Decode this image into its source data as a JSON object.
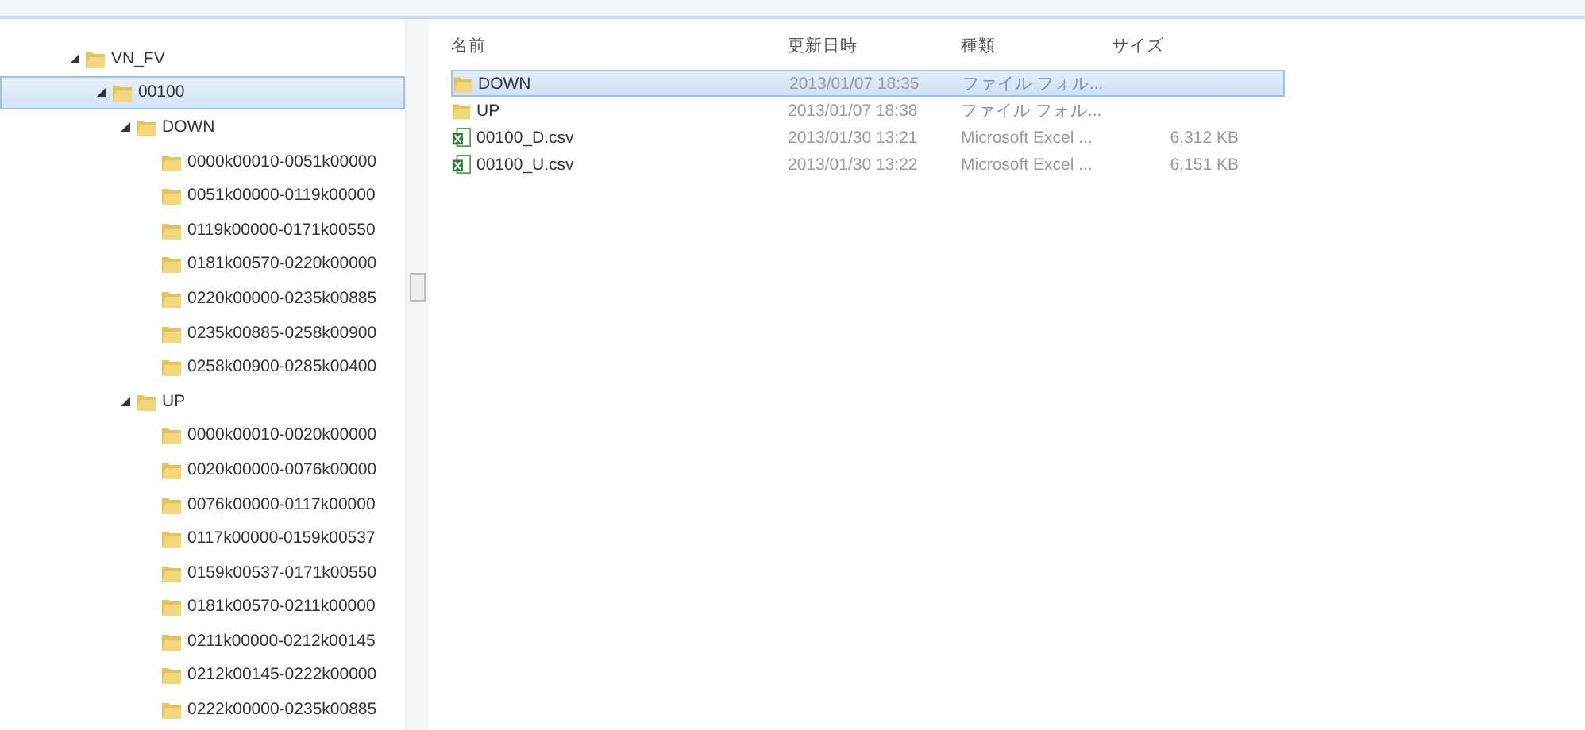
{
  "tree": [
    {
      "label": "VN_FV",
      "expanded": true,
      "selected": false,
      "children": [
        {
          "label": "00100",
          "expanded": true,
          "selected": true,
          "children": [
            {
              "label": "DOWN",
              "expanded": true,
              "selected": false,
              "children": [
                {
                  "label": "0000k00010-0051k00000",
                  "selected": false
                },
                {
                  "label": "0051k00000-0119k00000",
                  "selected": false
                },
                {
                  "label": "0119k00000-0171k00550",
                  "selected": false
                },
                {
                  "label": "0181k00570-0220k00000",
                  "selected": false
                },
                {
                  "label": "0220k00000-0235k00885",
                  "selected": false
                },
                {
                  "label": "0235k00885-0258k00900",
                  "selected": false
                },
                {
                  "label": "0258k00900-0285k00400",
                  "selected": false
                }
              ]
            },
            {
              "label": "UP",
              "expanded": true,
              "selected": false,
              "children": [
                {
                  "label": "0000k00010-0020k00000",
                  "selected": false
                },
                {
                  "label": "0020k00000-0076k00000",
                  "selected": false
                },
                {
                  "label": "0076k00000-0117k00000",
                  "selected": false
                },
                {
                  "label": "0117k00000-0159k00537",
                  "selected": false
                },
                {
                  "label": "0159k00537-0171k00550",
                  "selected": false
                },
                {
                  "label": "0181k00570-0211k00000",
                  "selected": false
                },
                {
                  "label": "0211k00000-0212k00145",
                  "selected": false
                },
                {
                  "label": "0212k00145-0222k00000",
                  "selected": false
                },
                {
                  "label": "0222k00000-0235k00885",
                  "selected": false
                }
              ]
            }
          ]
        }
      ]
    }
  ],
  "columns": [
    "名前",
    "更新日時",
    "種類",
    "サイズ"
  ],
  "files": [
    {
      "kind": "folder",
      "name": "DOWN",
      "date": "2013/01/07 18:35",
      "type": "ファイル フォル...",
      "selected": true
    },
    {
      "kind": "folder",
      "name": "UP",
      "date": "2013/01/07 18:38",
      "type": "ファイル フォル...",
      "selected": false
    },
    {
      "kind": "excel",
      "name": "00100_D.csv",
      "date": "2013/01/30 13:21",
      "type": "Microsoft Excel ...",
      "size": "6,312 KB",
      "selected": false
    },
    {
      "kind": "excel",
      "name": "00100_U.csv",
      "date": "2013/01/30 13:22",
      "type": "Microsoft Excel ...",
      "size": "6,151 KB",
      "selected": false
    }
  ]
}
